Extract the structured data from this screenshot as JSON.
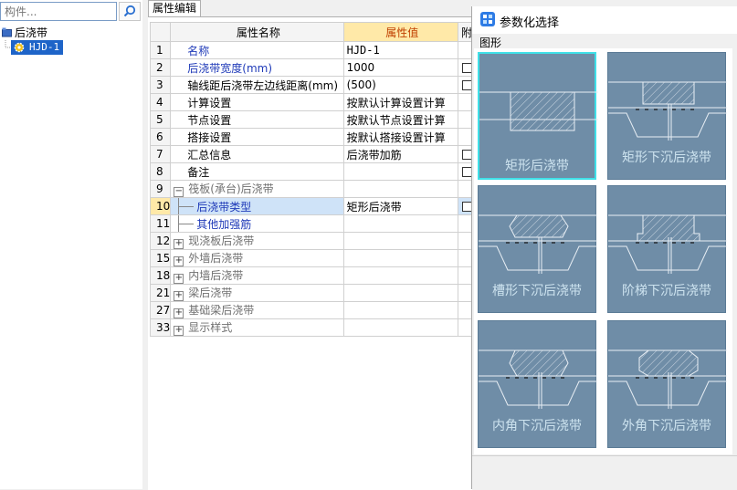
{
  "search": {
    "placeholder": "构件..."
  },
  "tree": {
    "root": {
      "label": "后浇带"
    },
    "child": {
      "label": "HJD-1"
    }
  },
  "property_panel": {
    "tab_label": "属性编辑",
    "headers": {
      "name": "属性名称",
      "value": "属性值",
      "extra": "附"
    },
    "rows": [
      {
        "num": "1",
        "name": "名称",
        "value": "HJD-1",
        "style": "blue",
        "checkbox": false
      },
      {
        "num": "2",
        "name": "后浇带宽度(mm)",
        "value": "1000",
        "style": "blue",
        "checkbox": true
      },
      {
        "num": "3",
        "name": "轴线距后浇带左边线距离(mm)",
        "value": "(500)",
        "style": "normal",
        "checkbox": true
      },
      {
        "num": "4",
        "name": "计算设置",
        "value": "按默认计算设置计算",
        "style": "normal",
        "checkbox": false
      },
      {
        "num": "5",
        "name": "节点设置",
        "value": "按默认节点设置计算",
        "style": "normal",
        "checkbox": false
      },
      {
        "num": "6",
        "name": "搭接设置",
        "value": "按默认搭接设置计算",
        "style": "normal",
        "checkbox": false
      },
      {
        "num": "7",
        "name": "汇总信息",
        "value": "后浇带加筋",
        "style": "normal",
        "checkbox": true
      },
      {
        "num": "8",
        "name": "备注",
        "value": "",
        "style": "normal",
        "checkbox": true
      },
      {
        "num": "9",
        "name": "筏板(承台)后浇带",
        "value": "",
        "style": "gray",
        "toggle": "−"
      },
      {
        "num": "10",
        "name": "后浇带类型",
        "value": "矩形后浇带",
        "style": "blue-child",
        "checkbox": true,
        "selected": true
      },
      {
        "num": "11",
        "name": "其他加强筋",
        "value": "",
        "style": "blue-child"
      },
      {
        "num": "12",
        "name": "现浇板后浇带",
        "value": "",
        "style": "gray",
        "toggle": "+"
      },
      {
        "num": "15",
        "name": "外墙后浇带",
        "value": "",
        "style": "gray",
        "toggle": "+"
      },
      {
        "num": "18",
        "name": "内墙后浇带",
        "value": "",
        "style": "gray",
        "toggle": "+"
      },
      {
        "num": "21",
        "name": "梁后浇带",
        "value": "",
        "style": "gray",
        "toggle": "+"
      },
      {
        "num": "27",
        "name": "基础梁后浇带",
        "value": "",
        "style": "gray",
        "toggle": "+"
      },
      {
        "num": "33",
        "name": "显示样式",
        "value": "",
        "style": "gray",
        "toggle": "+"
      }
    ]
  },
  "dialog": {
    "title": "参数化选择",
    "group_label": "图形",
    "options": [
      {
        "label": "矩形后浇带",
        "shape": "rect",
        "selected": true
      },
      {
        "label": "矩形下沉后浇带",
        "shape": "rect-sunk"
      },
      {
        "label": "槽形下沉后浇带",
        "shape": "trough-sunk"
      },
      {
        "label": "阶梯下沉后浇带",
        "shape": "step-sunk"
      },
      {
        "label": "内角下沉后浇带",
        "shape": "inner-sunk"
      },
      {
        "label": "外角下沉后浇带",
        "shape": "outer-sunk"
      }
    ]
  },
  "icons": {
    "search": "search-icon",
    "tree_root": "folder-icon",
    "tree_child": "gear-icon",
    "app": "app-icon"
  }
}
